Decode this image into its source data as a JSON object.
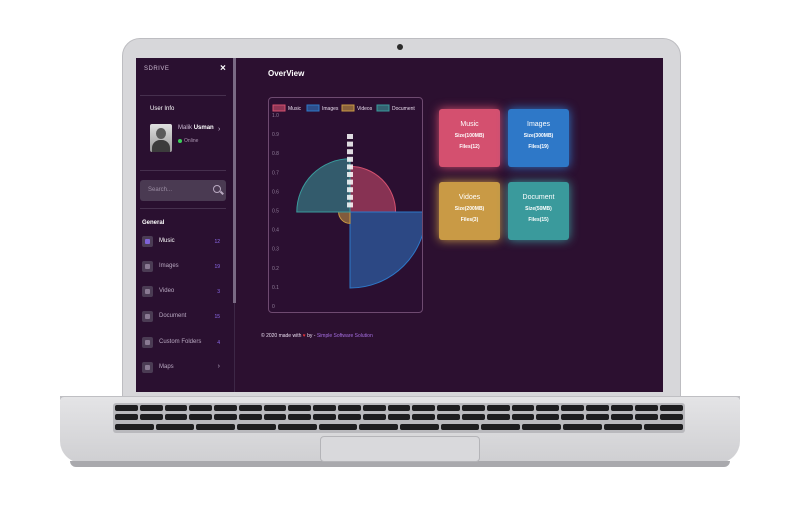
{
  "sidebar": {
    "brand": "SDRIVE",
    "close_icon": "×",
    "user_info_title": "User Info",
    "user": {
      "first": "Malik",
      "last": "Usman",
      "status": "Online"
    },
    "search_placeholder": "Search...",
    "section_title": "General",
    "items": [
      {
        "label": "Music",
        "count": "12",
        "icon": "music-icon"
      },
      {
        "label": "Images",
        "count": "19",
        "icon": "image-icon"
      },
      {
        "label": "Video",
        "count": "3",
        "icon": "video-icon"
      },
      {
        "label": "Document",
        "count": "15",
        "icon": "document-icon"
      },
      {
        "label": "Custom Folders",
        "count": "4",
        "icon": "folder-icon"
      },
      {
        "label": "Maps",
        "count": "",
        "icon": "map-icon"
      }
    ]
  },
  "main": {
    "title": "OverView",
    "footer": {
      "prefix": "© 2020 made with",
      "by": "by -",
      "brand": "Simple Software Solution"
    }
  },
  "cards": [
    {
      "title": "Music",
      "size": "Size(100MB)",
      "files": "Files(12)",
      "color": "#d4506f"
    },
    {
      "title": "Images",
      "size": "Size(300MB)",
      "files": "Files(19)",
      "color": "#2e78c8"
    },
    {
      "title": "Vidoes",
      "size": "Size(200MB)",
      "files": "Files(3)",
      "color": "#c99a45"
    },
    {
      "title": "Document",
      "size": "Size(50MB)",
      "files": "Files(15)",
      "color": "#3a9a9c"
    }
  ],
  "chart_data": {
    "type": "pie",
    "legend": [
      "Music",
      "Images",
      "Videos",
      "Document"
    ],
    "ticks": [
      "1.0",
      "0.9",
      "0.8",
      "0.7",
      "0.6",
      "0.5",
      "0.4",
      "0.3",
      "0.2",
      "0.1",
      "0"
    ],
    "series": [
      {
        "name": "Music",
        "value": 0.6,
        "color": "#d4506f"
      },
      {
        "name": "Images",
        "value": 1.0,
        "color": "#2e78c8"
      },
      {
        "name": "Videos",
        "value": 0.15,
        "color": "#c99a45"
      },
      {
        "name": "Document",
        "value": 0.7,
        "color": "#3a9a9c"
      }
    ],
    "legend_placement": "top"
  }
}
